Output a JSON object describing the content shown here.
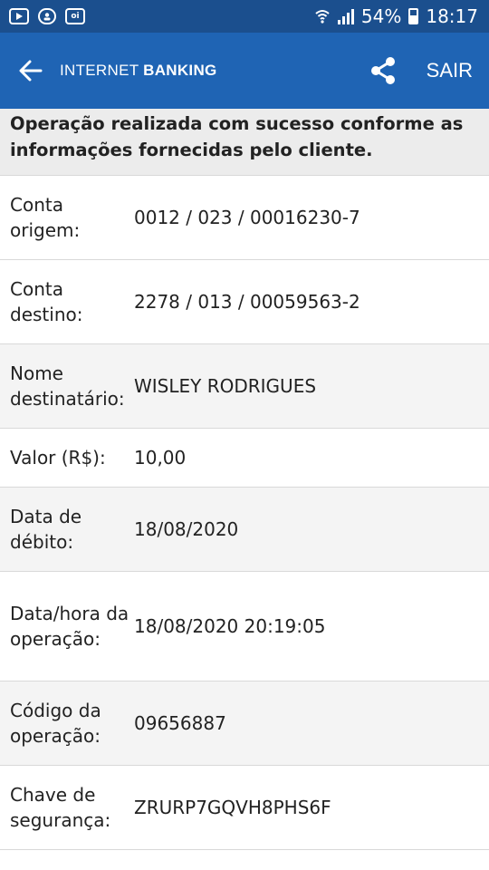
{
  "status_bar": {
    "battery": "54%",
    "time": "18:17"
  },
  "app_bar": {
    "brand_light": "INTERNET",
    "brand_bold": "BANKING",
    "exit_label": "SAIR"
  },
  "banner": "Operação realizada com sucesso conforme as informações fornecidas pelo cliente.",
  "rows": [
    {
      "label": "Conta origem:",
      "value": "0012 / 023 / 00016230-7"
    },
    {
      "label": "Conta destino:",
      "value": "2278 / 013 / 00059563-2"
    },
    {
      "label": "Nome destinatário:",
      "value": "WISLEY RODRIGUES"
    },
    {
      "label": "Valor (R$):",
      "value": "10,00"
    },
    {
      "label": "Data de débito:",
      "value": "18/08/2020"
    },
    {
      "label": "Data/hora da operação:",
      "value": "18/08/2020 20:19:05"
    },
    {
      "label": "Código da operação:",
      "value": "09656887"
    },
    {
      "label": "Chave de segurança:",
      "value": "ZRURP7GQVH8PHS6F"
    }
  ]
}
